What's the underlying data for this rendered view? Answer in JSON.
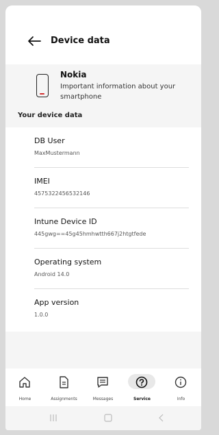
{
  "header": {
    "title": "Device data"
  },
  "device": {
    "name": "Nokia",
    "description": "Important information about your smartphone"
  },
  "section": {
    "title": "Your device data"
  },
  "rows": [
    {
      "label": "DB User",
      "value": "MaxMustermann"
    },
    {
      "label": "IMEI",
      "value": "4575322456532146"
    },
    {
      "label": "Intune Device ID",
      "value": "445gwg==45g45hmhwtth667j2htgtfede"
    },
    {
      "label": "Operating system",
      "value": "Android 14.0"
    },
    {
      "label": "App version",
      "value": "1.0.0"
    }
  ],
  "tabs": [
    {
      "label": "Home",
      "icon": "home-icon"
    },
    {
      "label": "Assignments",
      "icon": "document-icon"
    },
    {
      "label": "Messages",
      "icon": "chat-icon"
    },
    {
      "label": "Service",
      "icon": "help-circle-icon",
      "active": true
    },
    {
      "label": "Info",
      "icon": "info-icon"
    }
  ],
  "colors": {
    "accent": "#d32f2f"
  }
}
